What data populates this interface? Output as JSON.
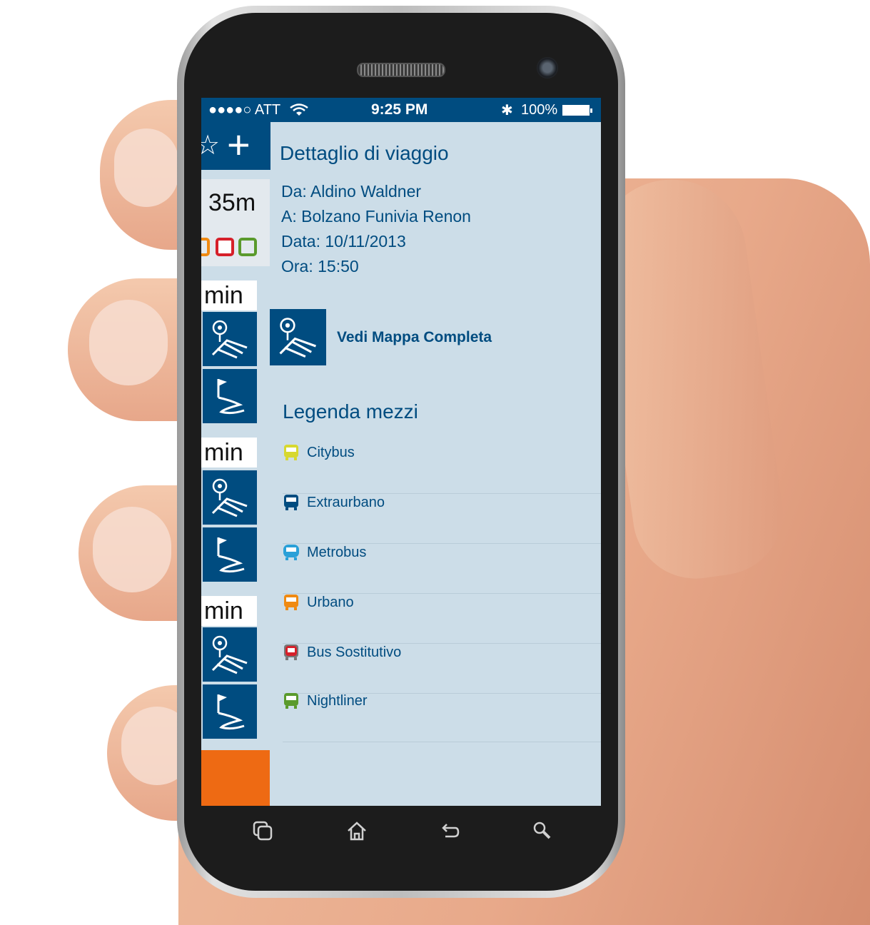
{
  "status_bar": {
    "carrier": "●●●●○ ATT",
    "time": "9:25 PM",
    "battery": "100%"
  },
  "sidebar": {
    "duration": "35m",
    "segment_unit": "min",
    "colors": {
      "header": "#004c80",
      "accent": "#ee6a13"
    }
  },
  "trip": {
    "title": "Dettaglio di viaggio",
    "from": "Da: Aldino Waldner",
    "to": "A: Bolzano Funivia Renon",
    "date": "Data: 10/11/2013",
    "time": "Ora: 15:50",
    "map_link": "Vedi Mappa Completa"
  },
  "legend": {
    "title": "Legenda mezzi",
    "items": [
      {
        "label": "Citybus",
        "color": "#d7d830"
      },
      {
        "label": "Extraurbano",
        "color": "#004c80"
      },
      {
        "label": "Metrobus",
        "color": "#2aa0d8"
      },
      {
        "label": "Urbano",
        "color": "#f08a12"
      },
      {
        "label": "Bus Sostitutivo",
        "color": "#d6202a"
      },
      {
        "label": "Nightliner",
        "color": "#5a9a2c"
      }
    ]
  },
  "nav_buttons": [
    "recent-apps-icon",
    "home-icon",
    "back-icon",
    "search-icon"
  ]
}
